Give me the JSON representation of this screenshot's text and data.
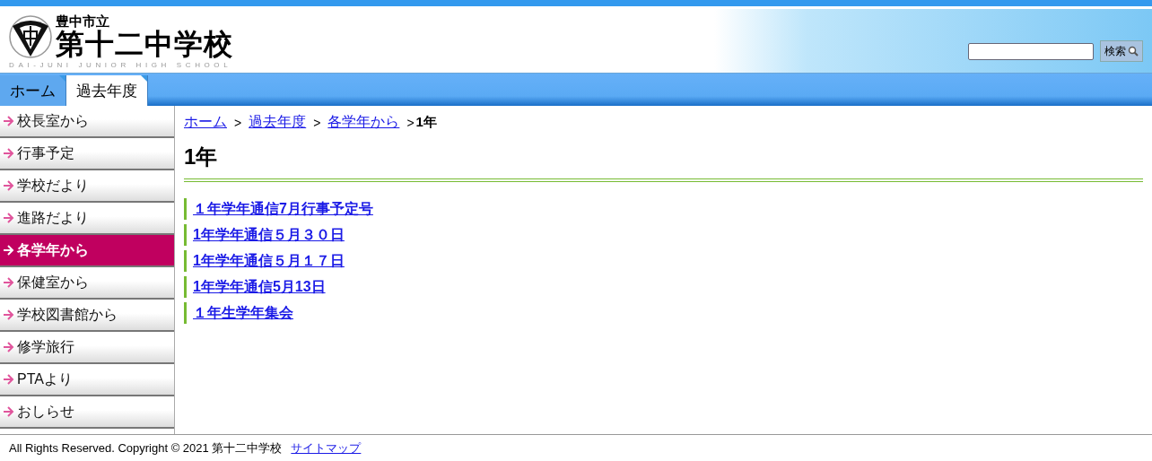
{
  "header": {
    "city": "豊中市立",
    "school": "第十二中学校",
    "english": "DAI-JUNI JUNIOR HIGH SCHOOL",
    "search": {
      "button": "検索"
    }
  },
  "tabs": [
    {
      "label": "ホーム",
      "selected": false
    },
    {
      "label": "過去年度",
      "selected": true
    }
  ],
  "sidebar": {
    "items": [
      {
        "label": "校長室から",
        "selected": false
      },
      {
        "label": "行事予定",
        "selected": false
      },
      {
        "label": "学校だより",
        "selected": false
      },
      {
        "label": "進路だより",
        "selected": false
      },
      {
        "label": "各学年から",
        "selected": true
      },
      {
        "label": "保健室から",
        "selected": false
      },
      {
        "label": "学校図書館から",
        "selected": false
      },
      {
        "label": "修学旅行",
        "selected": false
      },
      {
        "label": "PTAより",
        "selected": false
      },
      {
        "label": "おしらせ",
        "selected": false
      }
    ]
  },
  "breadcrumb": {
    "links": [
      "ホーム",
      "過去年度",
      "各学年から"
    ],
    "separator": ">",
    "current": "1年"
  },
  "heading": "1年",
  "links": [
    "１年学年通信7月行事予定号",
    "1年学年通信５月３０日",
    "1年学年通信５月１７日",
    "1年学年通信5月13日",
    "１年生学年集会"
  ],
  "footer": {
    "copyright": "All Rights Reserved. Copyright © 2021 第十二中学校",
    "sitemap": "サイトマップ"
  }
}
